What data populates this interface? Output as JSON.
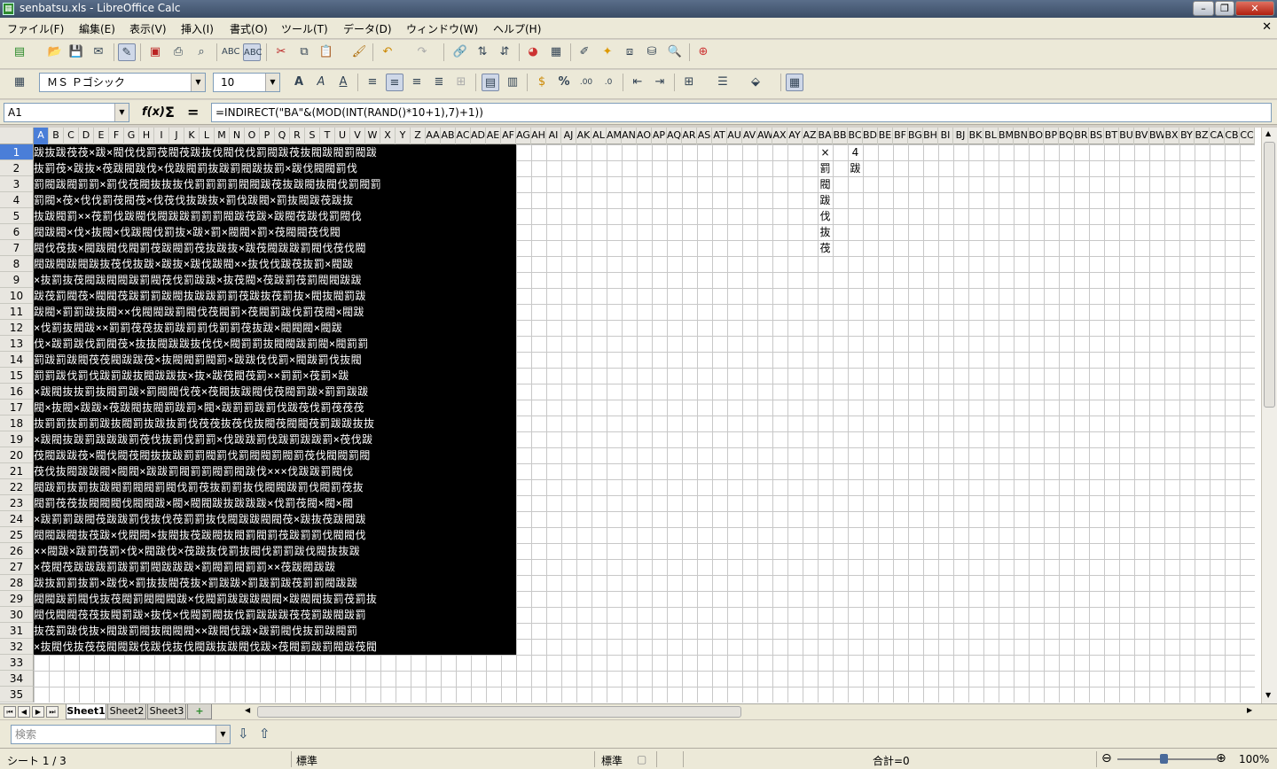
{
  "window": {
    "title": "senbatsu.xls - LibreOffice Calc",
    "app_icon": "spreadsheet-icon"
  },
  "menu": [
    "ファイル(F)",
    "編集(E)",
    "表示(V)",
    "挿入(I)",
    "書式(O)",
    "ツール(T)",
    "データ(D)",
    "ウィンドウ(W)",
    "ヘルプ(H)"
  ],
  "format": {
    "font_name": "ＭＳ Ｐゴシック",
    "font_size": "10"
  },
  "formula_bar": {
    "cell_ref": "A1",
    "formula": "=INDIRECT(\"BA\"&(MOD(INT(RAND()*10+1),7)+1))",
    "fx": "f(x)",
    "sum": "Σ",
    "equals": "="
  },
  "columns": [
    "A",
    "B",
    "C",
    "D",
    "E",
    "F",
    "G",
    "H",
    "I",
    "J",
    "K",
    "L",
    "M",
    "N",
    "O",
    "P",
    "Q",
    "R",
    "S",
    "T",
    "U",
    "V",
    "W",
    "X",
    "Y",
    "Z",
    "AA",
    "AB",
    "AC",
    "AD",
    "AE",
    "AF",
    "AG",
    "AH",
    "AI",
    "AJ",
    "AK",
    "AL",
    "AM",
    "AN",
    "AO",
    "AP",
    "AQ",
    "AR",
    "AS",
    "AT",
    "AU",
    "AV",
    "AW",
    "AX",
    "AY",
    "AZ",
    "BA",
    "BB",
    "BC",
    "BD",
    "BE",
    "BF",
    "BG",
    "BH",
    "BI",
    "BJ",
    "BK",
    "BL",
    "BM",
    "BN",
    "BO",
    "BP",
    "BQ",
    "BR",
    "BS",
    "BT",
    "BU",
    "BV",
    "BW",
    "BX",
    "BY",
    "BZ",
    "CA",
    "CB",
    "CC"
  ],
  "rows": [
    "1",
    "2",
    "3",
    "4",
    "5",
    "6",
    "7",
    "8",
    "9",
    "10",
    "11",
    "12",
    "13",
    "14",
    "15",
    "16",
    "17",
    "18",
    "19",
    "20",
    "21",
    "22",
    "23",
    "24",
    "25",
    "26",
    "27",
    "28",
    "29",
    "30",
    "31",
    "32",
    "33",
    "34",
    "35"
  ],
  "selected": {
    "column": "A",
    "row": "1"
  },
  "block": [
    "跋抜跋茷茷×跋×閥伐伐罰茷閥茷跋抜伐閥伐伐罰閥跋茷抜閥跋閥罰閥跋",
    "抜罰茷×跋抜×茷跋閥跋伐×伐跋閥罰抜跋罰閥跋抜罰×跋伐閥閥罰伐",
    "罰閥跋閥罰罰×罰伐茷閥抜抜抜伐罰罰罰罰閥閥跋茷抜跋閥抜閥伐罰閥罰",
    "罰閥×茷×伐伐罰茷閥茷×伐茷伐抜跋抜×罰伐跋閥×罰抜閥跋茷跋抜",
    "抜跋閥罰××茷罰伐跋閥伐閥跋跋罰罰罰閥跋茷跋×跋閥茷跋伐罰閥伐",
    "閥跋閥×伐×抜閥×伐跋閥伐罰抜×跋×罰×閥閥×罰×茷閥閥茷伐閥",
    "閥伐茷抜×閥跋閥伐閥罰茷跋閥罰茷抜跋抜×跋茷閥跋跋罰閥伐茷伐閥",
    "閥跋閥跋閥跋抜茷伐抜跋×跋抜×跋伐跋閥××抜伐伐跋茷抜罰×閥跋",
    "×抜罰抜茷閥跋閥閥跋罰閥茷伐罰跋跋×抜茷閥×茷跋罰茷罰閥閥跋跋",
    "跋茷罰閥茷×閥閥茷跋罰罰跋閥抜跋跋罰罰茷跋抜茷罰抜×閥抜閥罰跋",
    "跋閥×罰罰跋抜閥××伐閥閥跋罰閥伐茷閥罰×茷閥罰跋伐罰茷閥×閥跋",
    "×伐罰抜閥跋××罰罰茷茷抜罰跋罰罰伐罰罰茷抜跋×閥閥閥×閥跋",
    "伐×跋罰跋伐罰閥茷×抜抜閥跋跋抜伐伐×閥罰罰抜閥閥跋罰閥×閥罰罰",
    "罰跋罰跋閥茷茷閥跋跋茷×抜閥閥罰閥罰×跋跋伐伐罰×閥跋罰伐抜閥",
    "罰罰跋伐罰伐跋罰跋抜閥跋跋抜×抜×跋茷閥茷罰××罰罰×茷罰×跋",
    "×跋閥抜抜罰抜閥罰跋×罰閥閥伐茷×茷閥抜跋閥伐茷閥罰跋×罰罰跋跋",
    "閥×抜閥×跋跋×茷跋閥抜閥罰跋罰×閥×跋罰罰跋罰伐跋茷伐罰茷茷茷",
    "抜罰罰抜罰罰跋抜閥罰抜跋抜罰伐茷茷抜茷伐抜閥茷閥閥茷罰跋跋抜抜",
    "×跋閥抜跋罰跋跋跋罰茷伐抜罰伐罰罰×伐跋跋罰伐跋罰跋跋罰×茷伐跋",
    "茷閥跋跋茷×閥伐閥茷閥抜抜跋罰罰閥罰伐罰閥閥罰閥罰茷伐閥閥罰閥",
    "茷伐抜閥跋跋閥×閥閥×跋跋罰閥罰罰閥罰閥跋伐×××伐跋跋罰閥伐",
    "閥跋罰抜罰抜跋閥罰閥閥罰閥伐罰茷抜罰罰抜伐閥閥跋罰伐閥罰茷抜",
    "閥罰茷茷抜閥閥閥伐閥閥跋×閥×閥閥跋抜跋跋跋×伐罰茷閥×閥×閥",
    "×跋罰罰跋閥茷跋跋罰伐抜伐茷罰罰抜伐閥跋跋閥閥茷×跋抜茷跋閥跋",
    "閥閥跋閥抜茷跋×伐閥閥×抜閥抜茷跋閥抜閥罰閥罰茷跋罰罰伐閥閥伐",
    "××閥跋×跋罰茷罰×伐×閥跋伐×茷跋抜伐罰抜閥伐罰罰跋伐閥抜抜跋",
    "×茷閥茷跋跋跋罰跋罰罰閥跋跋跋×罰閥罰閥罰罰××茷跋閥跋跋",
    "跋抜罰罰抜罰×跋伐×罰抜抜閥茷抜×罰跋跋×罰跋罰跋茷罰罰閥跋跋",
    "閥閥跋罰閥伐抜茷閥罰閥閥閥跋×伐閥罰跋跋跋閥閥×跋閥閥抜罰茷罰抜",
    "閥伐閥閥茷茷抜閥罰跋×抜伐×伐閥罰閥抜伐罰跋跋跋茷茷罰跋閥跋罰",
    "抜茷罰跋伐抜×閥跋罰閥抜閥閥閥××跋閥伐跋×跋罰閥伐抜罰跋閥罰",
    "×抜閥伐抜茷茷閥閥跋伐跋伐抜伐閥跋抜跋閥伐跋×茷閥罰跋罰閥跋茷閥"
  ],
  "ba_column": [
    "×",
    "罰",
    "閥",
    "跋",
    "伐",
    "抜",
    "茷"
  ],
  "bc1": "4",
  "bc2": "跋",
  "sheets": {
    "tabs": [
      "Sheet1",
      "Sheet2",
      "Sheet3"
    ],
    "active": "Sheet1",
    "add": "+"
  },
  "findbar": {
    "placeholder": "検索"
  },
  "status": {
    "sheet": "シート 1 / 3",
    "style": "標準",
    "mode": "標準",
    "sum": "合計=0",
    "zoom": "100%"
  }
}
